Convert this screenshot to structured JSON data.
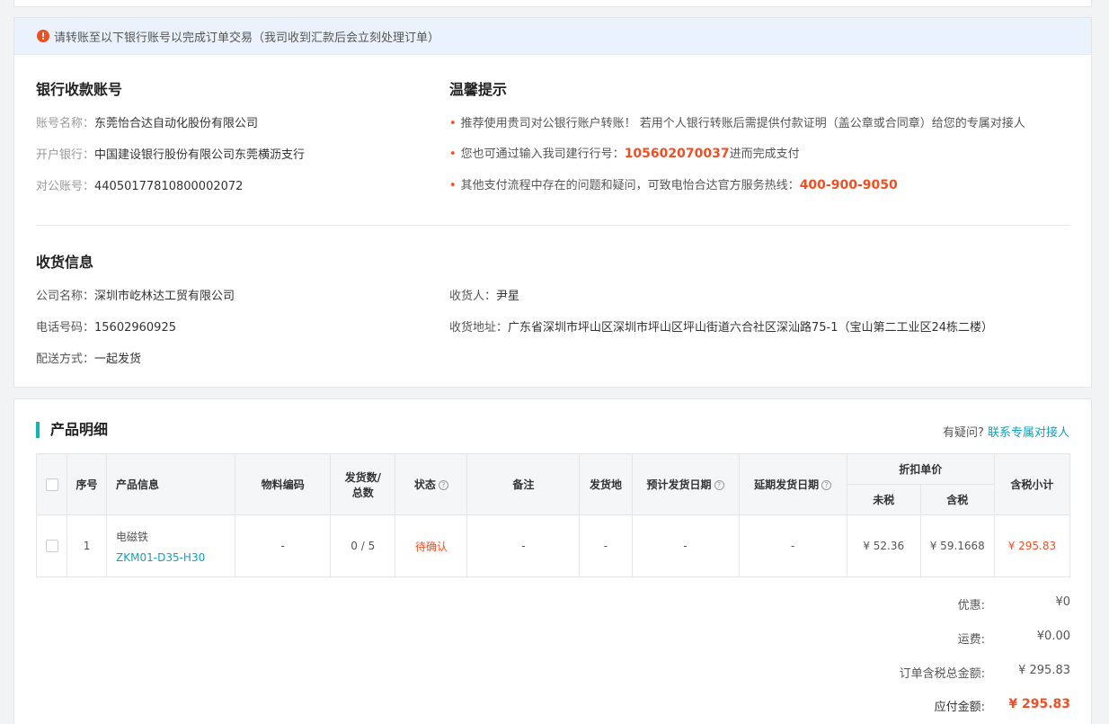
{
  "notice": {
    "icon": "exclamation-icon",
    "text": "请转账至以下银行账号以完成订单交易（我司收到汇款后会立刻处理订单）"
  },
  "bank": {
    "title": "银行收款账号",
    "account_name_label": "账号名称：",
    "account_name": "东莞怡合达自动化股份有限公司",
    "bank_label": "开户银行：",
    "bank": "中国建设银行股份有限公司东莞横沥支行",
    "account_no_label": "对公账号：",
    "account_no": "44050177810800002072"
  },
  "tips": {
    "title": "温馨提示",
    "tip1": "推荐使用贵司对公银行账户转账！ 若用个人银行转账后需提供付款证明（盖公章或合同章）给您的专属对接人",
    "tip2_prefix": "您也可通过输入我司建行行号：",
    "tip2_highlight": "105602070037",
    "tip2_suffix": "进而完成支付",
    "tip3_prefix": "其他支付流程中存在的问题和疑问，可致电怡合达官方服务热线：",
    "tip3_highlight": "400-900-9050",
    "bullet": "•"
  },
  "shipping": {
    "title": "收货信息",
    "company_label": "公司名称：",
    "company": "深圳市屹林达工贸有限公司",
    "phone_label": "电话号码：",
    "phone": "15602960925",
    "delivery_label": "配送方式：",
    "delivery": "一起发货",
    "receiver_label": "收货人：",
    "receiver": "尹星",
    "address_label": "收货地址：",
    "address": "广东省深圳市坪山区深圳市坪山区坪山街道六合社区深汕路75-1（宝山第二工业区24栋二楼）"
  },
  "products": {
    "title": "产品明细",
    "help_text": "有疑问?",
    "help_link": "联系专属对接人",
    "columns": {
      "seq": "序号",
      "info": "产品信息",
      "material": "物料编码",
      "shipped_line1": "发货数/",
      "shipped_line2": "总数",
      "status": "状态",
      "remark": "备注",
      "origin": "发货地",
      "est_date": "预计发货日期",
      "delay_date": "延期发货日期",
      "discount_price": "折扣单价",
      "no_tax": "未税",
      "with_tax": "含税",
      "subtotal": "含税小计"
    },
    "rows": [
      {
        "seq": "1",
        "name": "电磁铁",
        "code": "ZKM01-D35-H30",
        "material": "-",
        "shipped": "0 / 5",
        "status": "待确认",
        "remark": "-",
        "origin": "-",
        "est_date": "-",
        "delay_date": "-",
        "no_tax": "¥ 52.36",
        "with_tax": "¥ 59.1668",
        "subtotal": "¥ 295.83"
      }
    ]
  },
  "summary": {
    "discount_label": "优惠:",
    "discount": "¥0",
    "shipping_label": "运费:",
    "shipping": "¥0.00",
    "total_label": "订单含税总金额:",
    "total": "¥ 295.83",
    "payable_label": "应付金额:",
    "payable": "¥ 295.83"
  },
  "colors": {
    "accent": "#13b5b1",
    "link": "#13a0b8",
    "highlight": "#f04e23",
    "notice_bg": "#eaf3fd"
  }
}
